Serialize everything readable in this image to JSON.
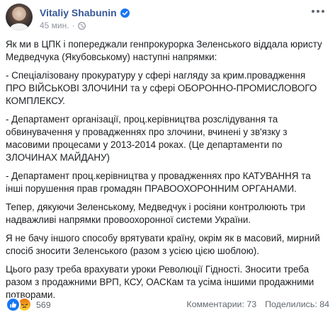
{
  "post": {
    "author": "Vitaliy Shabunin",
    "time": "45 мин.",
    "time_separator": "·",
    "paragraphs": [
      "Як ми в ЦПК і попереджали генпрокурорка Зеленського віддала юристу Медведчука (Якубовському) наступні напрямки:",
      "- Спеціалізовану прокуратуру у сфері нагляду за крим.провадження ПРО ВІЙСЬКОВІ ЗЛОЧИНИ та у сфері ОБОРОННО-ПРОМИСЛОВОГО КОМПЛЕКСУ.",
      "- Департамент організації, проц.керівництва розслідування та обвинувачення у провадженнях про злочини, вчинені у зв'язку з масовими процесами у 2013-2014 роках. (Це департаменти по ЗЛОЧИНАХ МАЙДАНУ)",
      "- Департамент проц.керівництва у провадженнях про КАТУВАННЯ та інші порушення прав громадян ПРАВООХОРОННИМ ОРГАНАМИ.",
      "Тепер, дякуючи Зеленському, Медведчук і росіяни контролюють три надважливі напрямки провоохоронної системи України.",
      "Я не бачу іншого способу врятувати країну, окрім як в масовий, мирний спосіб зносити Зеленського (разом з усією цією шоблою).",
      "Цього разу треба врахувати уроки Революції Гідності. Зносити треба разом з продажними ВРП, КСУ, ОАСКам та усіма іншими продажними потворами."
    ],
    "reaction_count": "569",
    "comments": "Комментарии: 73",
    "shares": "Поделились: 84",
    "colors": {
      "author": "#385898",
      "meta": "#90949c",
      "like": "#1877f2"
    },
    "icons": [
      "verified-badge-icon",
      "globe-icon",
      "more-options-icon",
      "like-reaction-icon",
      "angry-reaction-icon"
    ]
  }
}
